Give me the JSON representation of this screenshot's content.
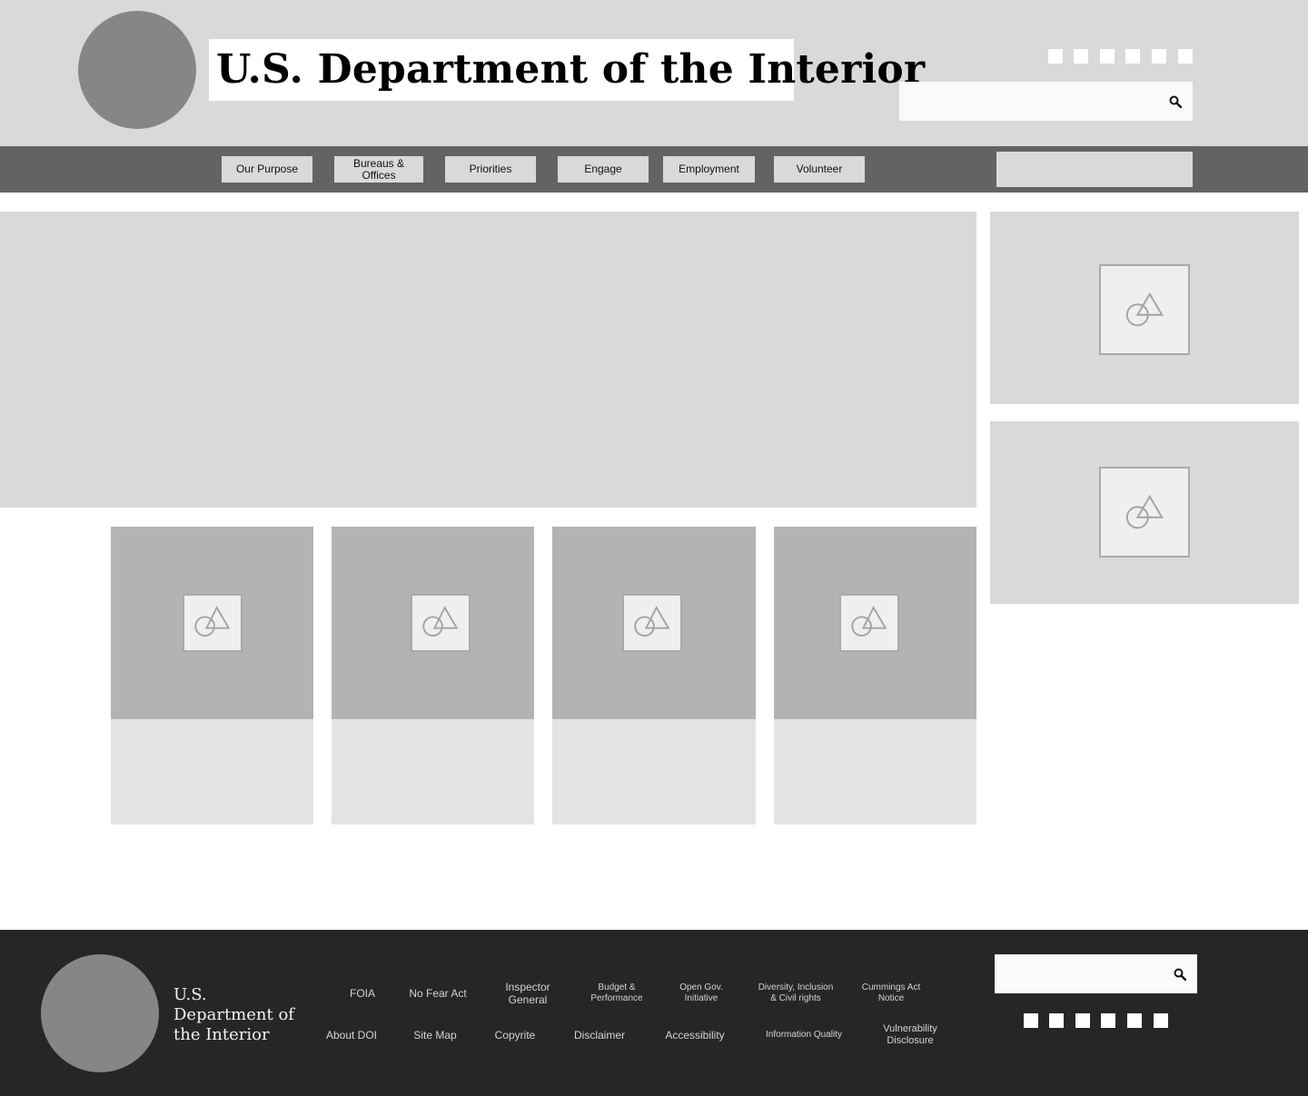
{
  "header": {
    "title": "U.S. Department of the Interior",
    "search": {
      "placeholder": "",
      "value": ""
    },
    "social_count": 6
  },
  "nav": {
    "items": [
      {
        "label": "Our Purpose"
      },
      {
        "label": "Bureaus & Offices"
      },
      {
        "label": "Priorities"
      },
      {
        "label": "Engage"
      },
      {
        "label": "Employment"
      },
      {
        "label": "Volunteer"
      }
    ]
  },
  "footer": {
    "title": "U.S. Department of the Interior",
    "links_row1": [
      {
        "label": "FOIA"
      },
      {
        "label": "No Fear Act"
      },
      {
        "label": "Inspector General"
      },
      {
        "label": "Budget & Performance"
      },
      {
        "label": "Open Gov. Initiative"
      },
      {
        "label": "Diversity, Inclusion & Civil rights"
      },
      {
        "label": "Cummings Act Notice"
      }
    ],
    "links_row2": [
      {
        "label": "About DOI"
      },
      {
        "label": "Site Map"
      },
      {
        "label": "Copyrite"
      },
      {
        "label": "Disclaimer"
      },
      {
        "label": "Accessibility"
      },
      {
        "label": "Information Quality"
      },
      {
        "label": "Vulnerability Disclosure"
      }
    ],
    "search": {
      "placeholder": "",
      "value": ""
    }
  },
  "icons": {
    "search": "search-icon",
    "image_placeholder": "image-placeholder-icon",
    "social": "social-icon"
  }
}
